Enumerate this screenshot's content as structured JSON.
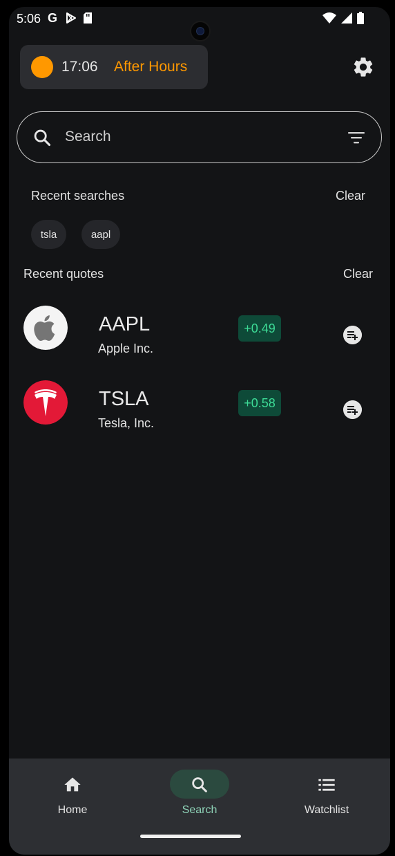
{
  "status_bar": {
    "time": "5:06"
  },
  "market": {
    "time": "17:06",
    "status": "After Hours",
    "color": "#ff9800"
  },
  "search": {
    "placeholder": "Search"
  },
  "recent_searches": {
    "title": "Recent searches",
    "clear_label": "Clear",
    "chips": [
      "tsla",
      "aapl"
    ]
  },
  "recent_quotes": {
    "title": "Recent quotes",
    "clear_label": "Clear",
    "items": [
      {
        "ticker": "AAPL",
        "name": "Apple Inc.",
        "change": "+0.49",
        "logo": "apple-logo"
      },
      {
        "ticker": "TSLA",
        "name": "Tesla, Inc.",
        "change": "+0.58",
        "logo": "tesla-logo"
      }
    ]
  },
  "nav": {
    "items": [
      {
        "label": "Home",
        "icon": "home-icon"
      },
      {
        "label": "Search",
        "icon": "search-icon",
        "active": true
      },
      {
        "label": "Watchlist",
        "icon": "list-icon"
      }
    ]
  },
  "colors": {
    "accent_positive": "#3ddc97",
    "positive_bg": "#0e4a38",
    "background": "#131416"
  }
}
